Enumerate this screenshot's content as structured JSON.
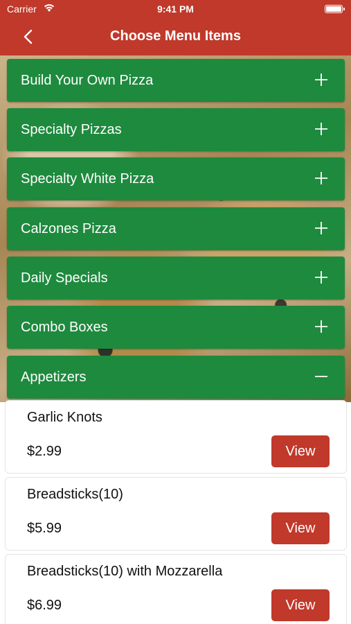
{
  "status_bar": {
    "carrier": "Carrier",
    "time": "9:41 PM"
  },
  "nav": {
    "title": "Choose Menu Items"
  },
  "categories": [
    {
      "label": "Build Your Own Pizza",
      "expanded": false
    },
    {
      "label": "Specialty Pizzas",
      "expanded": false
    },
    {
      "label": "Specialty White Pizza",
      "expanded": false
    },
    {
      "label": "Calzones Pizza",
      "expanded": false
    },
    {
      "label": "Daily Specials",
      "expanded": false
    },
    {
      "label": "Combo Boxes",
      "expanded": false
    },
    {
      "label": "Appetizers",
      "expanded": true
    }
  ],
  "items": [
    {
      "name": "Garlic Knots",
      "price": "$2.99",
      "button": "View"
    },
    {
      "name": "Breadsticks(10)",
      "price": "$5.99",
      "button": "View"
    },
    {
      "name": "Breadsticks(10) with Mozzarella",
      "price": "$6.99",
      "button": "View"
    }
  ],
  "colors": {
    "header": "#c0392b",
    "category": "#1e8a3e",
    "button": "#c0392b"
  }
}
